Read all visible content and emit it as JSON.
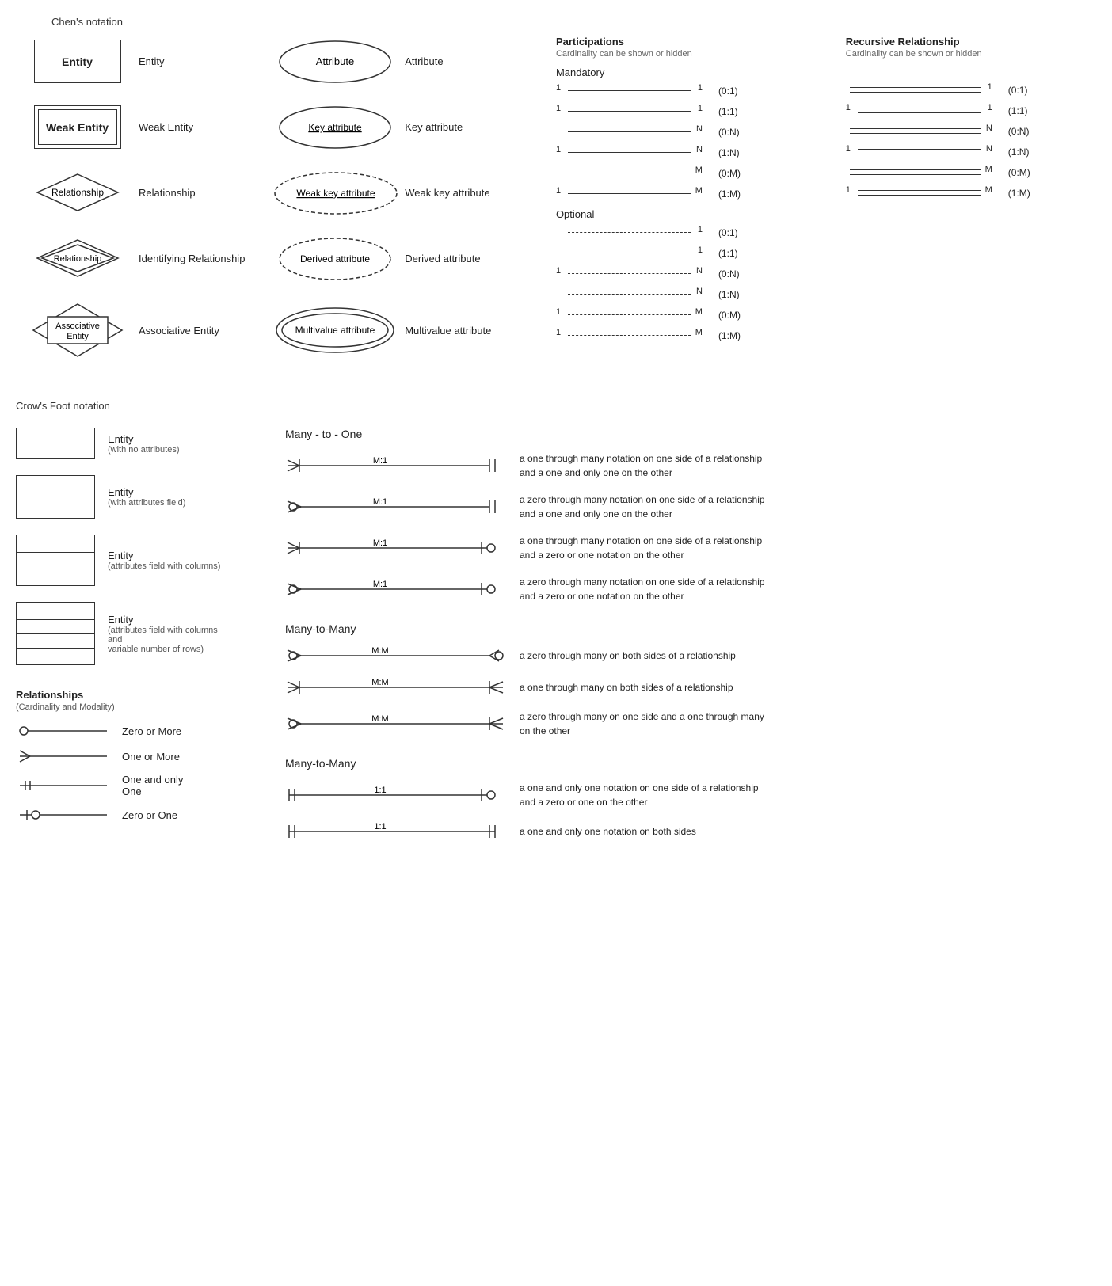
{
  "page": {
    "chen_title": "Chen's notation",
    "chen_items": [
      {
        "label": "Entity",
        "type": "entity"
      },
      {
        "label": "Weak Entity",
        "type": "weak-entity"
      },
      {
        "label": "Relationship",
        "type": "relationship"
      },
      {
        "label": "Identifying Relationship",
        "type": "identifying-relationship"
      },
      {
        "label": "Associative Entity",
        "type": "associative-entity"
      }
    ],
    "attr_items": [
      {
        "label": "Attribute",
        "type": "ellipse-normal",
        "text": "Attribute"
      },
      {
        "label": "Key attribute",
        "type": "ellipse-underline",
        "text": "Key attribute"
      },
      {
        "label": "Weak key attribute",
        "type": "ellipse-underline-dashed",
        "text": "Weak key attribute"
      },
      {
        "label": "Derived attribute",
        "type": "ellipse-dashed",
        "text": "Derived attribute"
      },
      {
        "label": "Multivalue attribute",
        "type": "ellipse-double",
        "text": "Multivalue attribute"
      }
    ],
    "participations_title": "Participations",
    "participations_sub": "Cardinality can be shown or hidden",
    "mandatory_label": "Mandatory",
    "optional_label": "Optional",
    "mandatory_rows": [
      {
        "left": "1",
        "right": "1",
        "notation": "(0:1)"
      },
      {
        "left": "1",
        "right": "1",
        "notation": "(1:1)"
      },
      {
        "left": "",
        "right": "N",
        "notation": "(0:N)"
      },
      {
        "left": "1",
        "right": "N",
        "notation": "(1:N)"
      },
      {
        "left": "",
        "right": "M",
        "notation": "(0:M)"
      },
      {
        "left": "1",
        "right": "M",
        "notation": "(1:M)"
      }
    ],
    "optional_rows": [
      {
        "left": "",
        "right": "1",
        "notation": "(0:1)"
      },
      {
        "left": "",
        "right": "1",
        "notation": "(1:1)"
      },
      {
        "left": "1",
        "right": "N",
        "notation": "(0:N)"
      },
      {
        "left": "",
        "right": "N",
        "notation": "(1:N)"
      },
      {
        "left": "1",
        "right": "M",
        "notation": "(0:M)"
      },
      {
        "left": "1",
        "right": "M",
        "notation": "(1:M)"
      }
    ],
    "recursive_title": "Recursive Relationship",
    "recursive_sub": "Cardinality can be shown or hidden",
    "recursive_rows": [
      {
        "left": "",
        "right": "1",
        "notation": "(0:1)"
      },
      {
        "left": "1",
        "right": "1",
        "notation": "(1:1)"
      },
      {
        "left": "",
        "right": "N",
        "notation": "(0:N)"
      },
      {
        "left": "1",
        "right": "N",
        "notation": "(1:N)"
      },
      {
        "left": "",
        "right": "M",
        "notation": "(0:M)"
      },
      {
        "left": "1",
        "right": "M",
        "notation": "(1:M)"
      }
    ],
    "crows_title": "Crow's Foot notation",
    "crows_entity_items": [
      {
        "label": "Entity",
        "sublabel": "(with no attributes)",
        "type": "simple"
      },
      {
        "label": "Entity",
        "sublabel": "(with attributes field)",
        "type": "attrs"
      },
      {
        "label": "Entity",
        "sublabel": "(attributes field with columns)",
        "type": "cols"
      },
      {
        "label": "Entity",
        "sublabel": "(attributes field with columns and\nvariable number of rows)",
        "type": "rows"
      }
    ],
    "relationships_title": "Relationships",
    "relationships_sub": "(Cardinality and Modality)",
    "rel_items": [
      {
        "label": "Zero or More",
        "type": "zero-or-more"
      },
      {
        "label": "One or More",
        "type": "one-or-more"
      },
      {
        "label": "One and only One",
        "type": "one-and-only"
      },
      {
        "label": "Zero or One",
        "type": "zero-or-one"
      }
    ],
    "many_to_one_title": "Many - to - One",
    "many_to_one_rows": [
      {
        "label": "M:1",
        "desc": "a one through many notation on one side of a relationship\nand a one and only one on the other",
        "left_type": "one-through-many",
        "right_type": "one-only"
      },
      {
        "label": "M:1",
        "desc": "a zero through many notation on one side of a relationship\nand a one and only one on the other",
        "left_type": "zero-through-many",
        "right_type": "one-only"
      },
      {
        "label": "M:1",
        "desc": "a one through many notation on one side of a relationship\nand a zero or one notation on the other",
        "left_type": "one-through-many",
        "right_type": "zero-or-one"
      },
      {
        "label": "M:1",
        "desc": "a zero through many notation on one side of a relationship\nand a zero or one notation on the other",
        "left_type": "zero-through-many",
        "right_type": "zero-or-one"
      }
    ],
    "many_to_many_title1": "Many-to-Many",
    "many_to_many_rows1": [
      {
        "label": "M:M",
        "desc": "a zero through many on both sides of a relationship",
        "left_type": "zero-through-many",
        "right_type": "zero-through-many-r"
      },
      {
        "label": "M:M",
        "desc": "a one through many on both sides of a relationship",
        "left_type": "one-through-many",
        "right_type": "one-through-many-r"
      },
      {
        "label": "M:M",
        "desc": "a zero through many on one side and a one through many\non the other",
        "left_type": "zero-through-many",
        "right_type": "one-through-many-r"
      }
    ],
    "many_to_many_title2": "Many-to-Many",
    "many_to_many_rows2": [
      {
        "label": "1:1",
        "desc": "a one and only one notation on one side of a relationship\nand a zero or one on the other",
        "left_type": "one-only-l",
        "right_type": "zero-or-one"
      },
      {
        "label": "1:1",
        "desc": "a one and only one notation on both sides",
        "left_type": "one-only-l",
        "right_type": "one-only"
      }
    ]
  }
}
